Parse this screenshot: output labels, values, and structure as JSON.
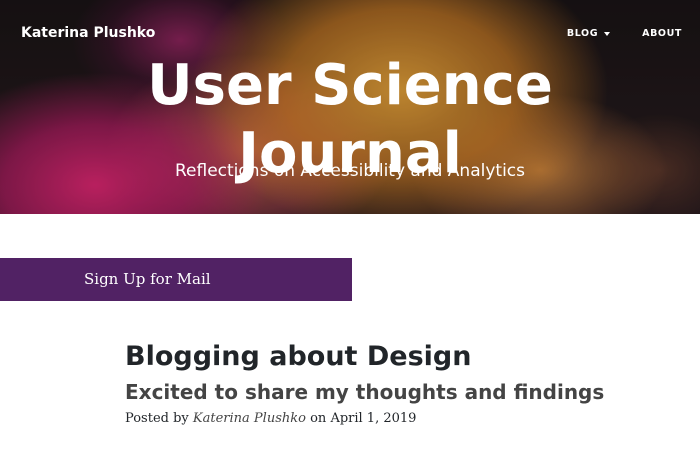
{
  "header": {
    "brand": "Katerina Plushko",
    "nav": {
      "blog_label": "BLOG",
      "about_label": "ABOUT"
    },
    "title_line1": "User Science",
    "title_line2": "Journal",
    "subtitle": "Reflections on Accessibility and Analytics"
  },
  "signup": {
    "label": "Sign Up for Mail",
    "color": "#512264"
  },
  "post": {
    "title": "Blogging about Design",
    "subtitle": "Excited to share my thoughts and findings",
    "meta_prefix": "Posted by",
    "author": "Katerina Plushko",
    "meta_on": "on",
    "date": "April 1, 2019"
  }
}
